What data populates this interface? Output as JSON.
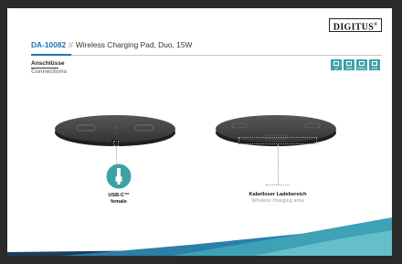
{
  "brand": {
    "logo_text": "DIGITUS",
    "logo_mark": "®"
  },
  "header": {
    "model": "DA-10082",
    "separator": "//",
    "product": "Wireless Charging Pad, Duo, 15W"
  },
  "section": {
    "title_de": "Anschlüsse",
    "title_en": "Connections"
  },
  "badges": [
    {
      "icon": "wireless-icon",
      "text": "Qi"
    },
    {
      "icon": "power-icon",
      "text": "15W"
    },
    {
      "icon": "usbc-icon",
      "text": "USB-C"
    },
    {
      "icon": "led-icon",
      "text": "LED"
    }
  ],
  "callouts": {
    "usb": {
      "de": "USB-C™",
      "en": "female"
    },
    "charging": {
      "de": "Kabelloser Ladebereich",
      "en": "Wireless charging area"
    }
  },
  "colors": {
    "accent": "#1f72b8",
    "teal": "#3ea1a8",
    "pad": "#3b3b3b"
  }
}
